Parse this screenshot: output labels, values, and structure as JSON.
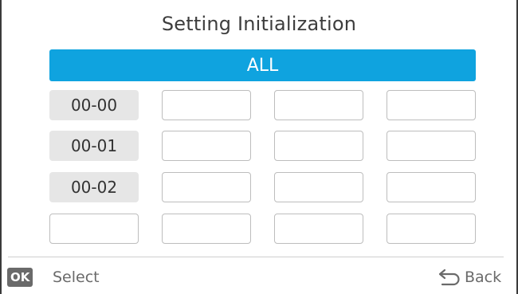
{
  "title": "Setting Initialization",
  "all_label": "ALL",
  "grid": {
    "rows": [
      [
        "00-00",
        "",
        "",
        ""
      ],
      [
        "00-01",
        "",
        "",
        ""
      ],
      [
        "00-02",
        "",
        "",
        ""
      ],
      [
        "",
        "",
        "",
        ""
      ]
    ]
  },
  "footer": {
    "ok_badge": "OK",
    "select_label": "Select",
    "back_label": "Back"
  },
  "colors": {
    "accent": "#0fa3df",
    "cell_fill": "#e6e6e6"
  }
}
